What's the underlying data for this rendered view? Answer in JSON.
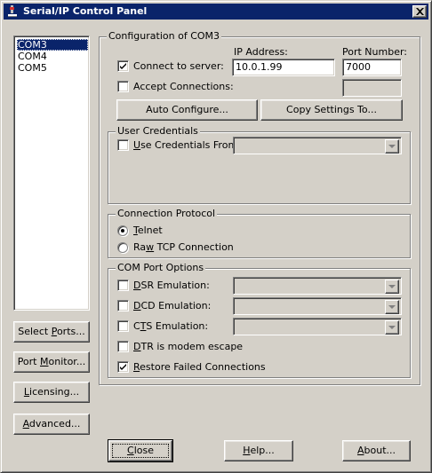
{
  "window": {
    "title": "Serial/IP Control Panel",
    "icons": {
      "app": "serial-ip-app-icon",
      "close": "close-icon"
    }
  },
  "ports": {
    "items": [
      "COM3",
      "COM4",
      "COM5"
    ],
    "selected": "COM3"
  },
  "side_buttons": {
    "select_ports": {
      "pre": "Select ",
      "key": "P",
      "post": "orts..."
    },
    "port_monitor": {
      "pre": "Port ",
      "key": "M",
      "post": "onitor..."
    },
    "licensing": {
      "pre": "",
      "key": "L",
      "post": "icensing..."
    },
    "advanced": {
      "pre": "",
      "key": "A",
      "post": "dvanced..."
    }
  },
  "configuration": {
    "group_title": "Configuration of COM3",
    "ip_address_label": "IP Address:",
    "port_number_label": "Port Number:",
    "connect_to_server": {
      "label": "Connect to server:",
      "checked": true,
      "ip_address": "10.0.1.99",
      "port_number": "7000"
    },
    "accept_connections": {
      "label": "Accept Connections:",
      "checked": false,
      "port_number": ""
    },
    "auto_configure_button": "Auto Configure...",
    "copy_settings_button": "Copy Settings To..."
  },
  "user_credentials": {
    "group_title": "User Credentials",
    "use_credentials_from": {
      "pre": "",
      "key": "U",
      "post": "se Credentials From:",
      "checked": false,
      "value": ""
    }
  },
  "connection_protocol": {
    "group_title": "Connection Protocol",
    "telnet": {
      "pre": "",
      "key": "T",
      "post": "elnet",
      "selected": true
    },
    "raw_tcp": {
      "pre": "Ra",
      "key": "w",
      "post": " TCP Connection",
      "selected": false
    }
  },
  "com_port_options": {
    "group_title": "COM Port Options",
    "dsr_emulation": {
      "pre": "",
      "key": "D",
      "post": "SR Emulation:",
      "checked": false,
      "value": ""
    },
    "dcd_emulation": {
      "pre": "",
      "key": "D",
      "post": "CD Emulation:",
      "checked": false,
      "value": ""
    },
    "cts_emulation": {
      "pre": "C",
      "key": "T",
      "post": "S Emulation:",
      "checked": false,
      "value": ""
    },
    "dtr_modem_escape": {
      "pre": "",
      "key": "D",
      "post": "TR is modem escape",
      "checked": false
    },
    "restore_failed": {
      "pre": "",
      "key": "R",
      "post": "estore Failed Connections",
      "checked": true
    }
  },
  "footer": {
    "close": {
      "pre": "",
      "key": "C",
      "post": "lose"
    },
    "help": {
      "pre": "",
      "key": "H",
      "post": "elp..."
    },
    "about": {
      "pre": "",
      "key": "A",
      "post": "bout..."
    }
  },
  "colors": {
    "title_bar": "#0a246a",
    "face": "#d4d0c8",
    "selection": "#0a246a"
  }
}
